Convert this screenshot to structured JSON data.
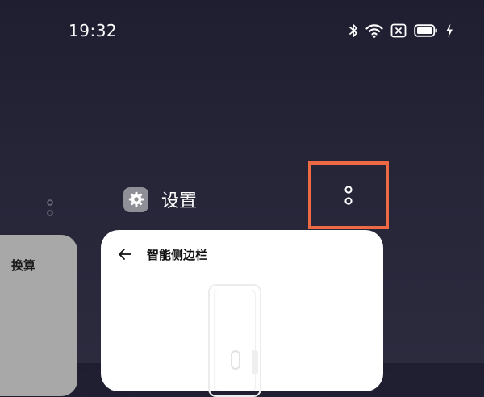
{
  "status_bar": {
    "time": "19:32",
    "icons": [
      "bluetooth-icon",
      "wifi-icon",
      "sim-none-icon",
      "battery-icon",
      "charging-bolt-icon"
    ]
  },
  "recents": {
    "left_card": {
      "label": "换算"
    },
    "current_app": {
      "name": "设置",
      "icon": "gear-icon"
    },
    "card": {
      "page_title": "智能侧边栏"
    }
  },
  "colors": {
    "highlight": "#ee6a45",
    "background": "#24233a",
    "card": "#ffffff",
    "side_card": "#a8a8a8"
  }
}
